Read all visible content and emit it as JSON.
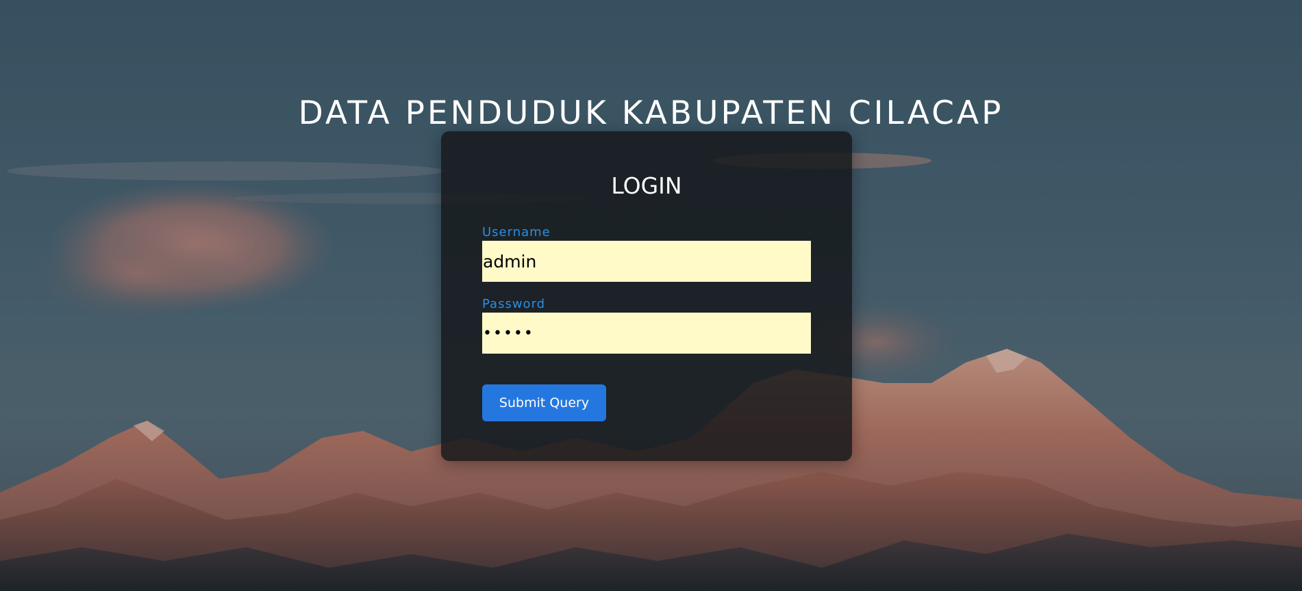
{
  "page": {
    "title": "DATA PENDUDUK KABUPATEN CILACAP"
  },
  "login": {
    "heading": "LOGIN",
    "username_label": "Username",
    "username_value": "admin",
    "password_label": "Password",
    "password_value": "admin",
    "submit_label": "Submit Query"
  },
  "colors": {
    "label": "#2b8fe0",
    "input_background": "#fffac8",
    "button": "#2577e0",
    "card_background": "#141618"
  },
  "background": {
    "description_icon": "mountain-sunset-image"
  }
}
